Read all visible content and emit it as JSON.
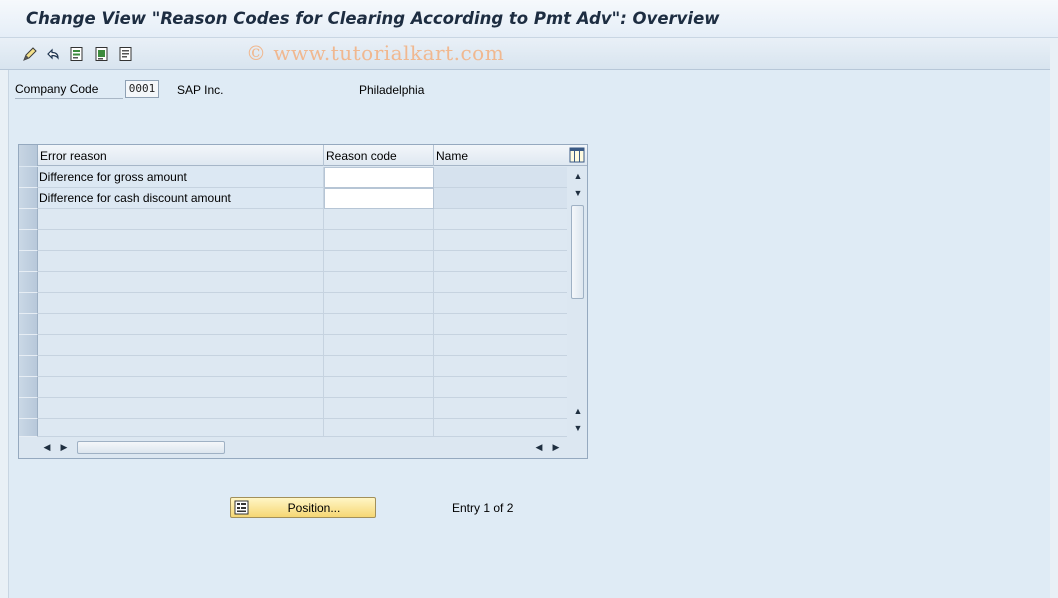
{
  "window": {
    "title": "Change View \"Reason Codes for Clearing According to Pmt Adv\": Overview",
    "watermark": "© www.tutorialkart.com"
  },
  "toolbar": {
    "icons": [
      "display-change-icon",
      "undo-icon",
      "details-icon",
      "select-all-icon",
      "deselect-icon"
    ]
  },
  "header_fields": {
    "company_code_label": "Company Code",
    "company_code_value": "0001",
    "company_name": "SAP Inc.",
    "city": "Philadelphia"
  },
  "table": {
    "columns": [
      "Error reason",
      "Reason code",
      "Name"
    ],
    "rows": [
      {
        "error_reason": "Difference for gross amount",
        "reason_code": "",
        "name": ""
      },
      {
        "error_reason": "Difference for cash discount amount",
        "reason_code": "",
        "name": ""
      }
    ],
    "empty_rows": 11
  },
  "footer": {
    "position_button": "Position...",
    "entry_text": "Entry 1 of 2"
  },
  "colors": {
    "background": "#dfebf5",
    "button_yellow": "#f6d774",
    "title_text": "#1d2d41"
  }
}
